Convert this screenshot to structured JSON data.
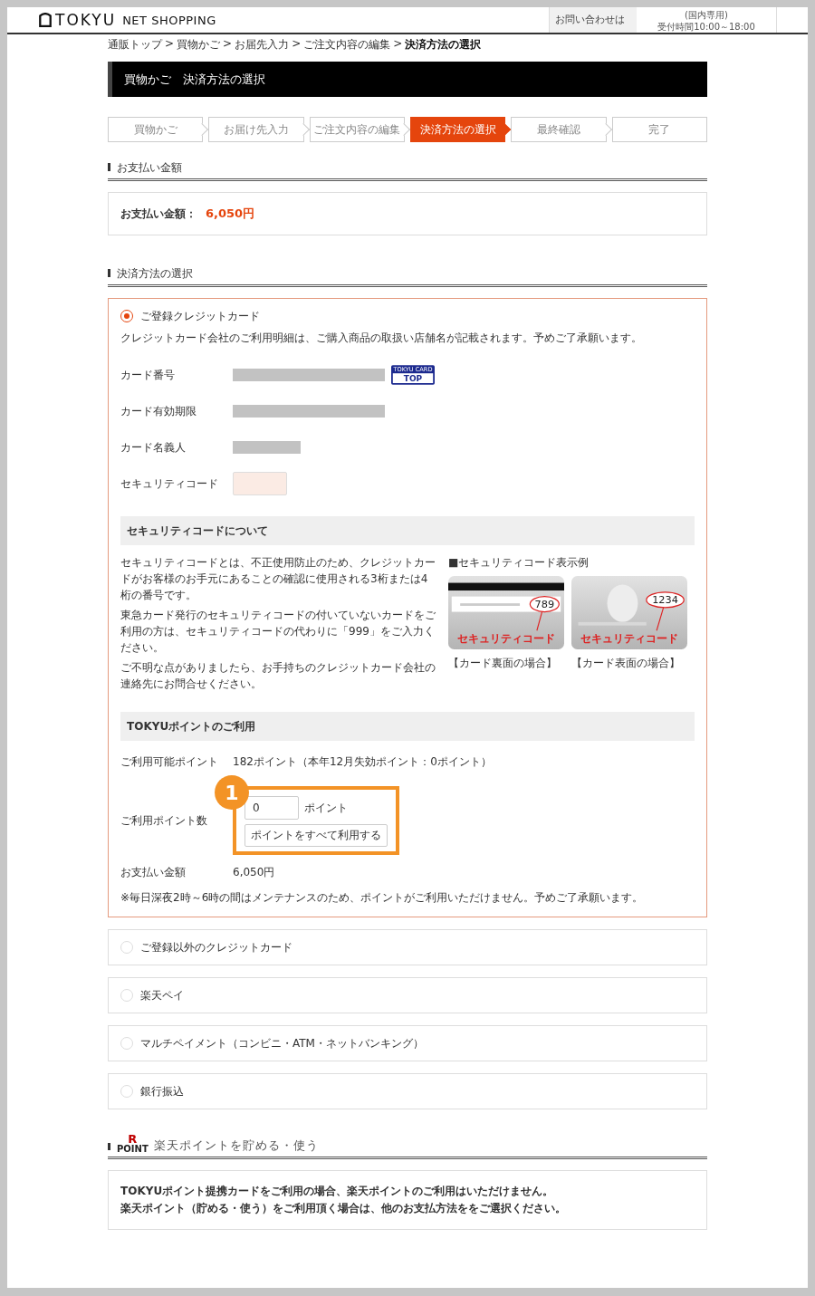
{
  "header": {
    "logo_mark": "TOKYU",
    "logo_text": "NET SHOPPING",
    "contact_label": "お問い合わせは",
    "contact_note": "(国内専用)",
    "contact_hours": "受付時間10:00～18:00"
  },
  "breadcrumb": {
    "separator": ">",
    "items": [
      "通販トップ",
      "買物かご",
      "お届先入力",
      "ご注文内容の編集",
      "決済方法の選択"
    ]
  },
  "page_title": "買物かご　決済方法の選択",
  "steps": [
    {
      "label": "買物かご",
      "selected": false
    },
    {
      "label": "お届け先入力",
      "selected": false
    },
    {
      "label": "ご注文内容の編集",
      "selected": false
    },
    {
      "label": "決済方法の選択",
      "selected": true
    },
    {
      "label": "最終確認",
      "selected": false
    },
    {
      "label": "完了",
      "selected": false
    }
  ],
  "payment_amount": {
    "heading": "お支払い金額",
    "label": "お支払い金額：",
    "value": "6,050円"
  },
  "payment_method": {
    "heading": "決済方法の選択",
    "options": [
      {
        "label": "ご登録クレジットカード",
        "selected": true
      },
      {
        "label": "ご登録以外のクレジットカード",
        "selected": false
      },
      {
        "label": "楽天ペイ",
        "selected": false
      },
      {
        "label": "マルチペイメント（コンビニ・ATM・ネットバンキング）",
        "selected": false
      },
      {
        "label": "銀行振込",
        "selected": false
      }
    ]
  },
  "registered_card": {
    "notice": "クレジットカード会社のご利用明細は、ご購入商品の取扱い店舗名が記載されます。予めご了承願います。",
    "card_brand_top": "TOKYU CARD",
    "card_brand": "TOP",
    "fields": [
      {
        "label": "カード番号",
        "kind": "masked",
        "brand": true
      },
      {
        "label": "カード有効期限",
        "kind": "masked",
        "brand": false
      },
      {
        "label": "カード名義人",
        "kind": "masked",
        "brand": false
      },
      {
        "label": "セキュリティコード",
        "kind": "input",
        "brand": false
      }
    ]
  },
  "security_info": {
    "heading": "セキュリティコードについて",
    "paragraphs": [
      "セキュリティコードとは、不正使用防止のため、クレジットカードがお客様のお手元にあることの確認に使用される3桁または4桁の番号です。",
      "東急カード発行のセキュリティコードの付いていないカードをご利用の方は、セキュリティコードの代わりに「999」をご入力ください。",
      "ご不明な点がありましたら、お手持ちのクレジットカード会社の連絡先にお問合せください。"
    ],
    "example_heading": "■セキュリティコード表示例",
    "examples": [
      {
        "kind": "back",
        "code": "789",
        "code_label": "セキュリティコード",
        "caption": "【カード裏面の場合】"
      },
      {
        "kind": "front",
        "code": "1234",
        "code_label": "セキュリティコード",
        "caption": "【カード表面の場合】"
      }
    ]
  },
  "points": {
    "heading": "TOKYUポイントのご利用",
    "available_label": "ご利用可能ポイント",
    "available_value": "182ポイント（本年12月失効ポイント：0ポイント）",
    "use_label": "ご利用ポイント数",
    "use_value": "0",
    "use_unit": "ポイント",
    "use_all_button": "ポイントをすべて利用する",
    "amount_label": "お支払い金額",
    "amount_value": "6,050円",
    "note": "※毎日深夜2時～6時の間はメンテナンスのため、ポイントがご利用いただけません。予めご了承願います。"
  },
  "annotation": {
    "label": "1"
  },
  "rakuten": {
    "logo_letter": "R",
    "logo_word": "POINT",
    "heading": "楽天ポイントを貯める・使う",
    "lines": [
      "TOKYUポイント提携カードをご利用の場合、楽天ポイントのご利用はいただけません。",
      "楽天ポイント（貯める・使う）をご利用頂く場合は、他のお支払方法ををご選択ください。"
    ]
  }
}
